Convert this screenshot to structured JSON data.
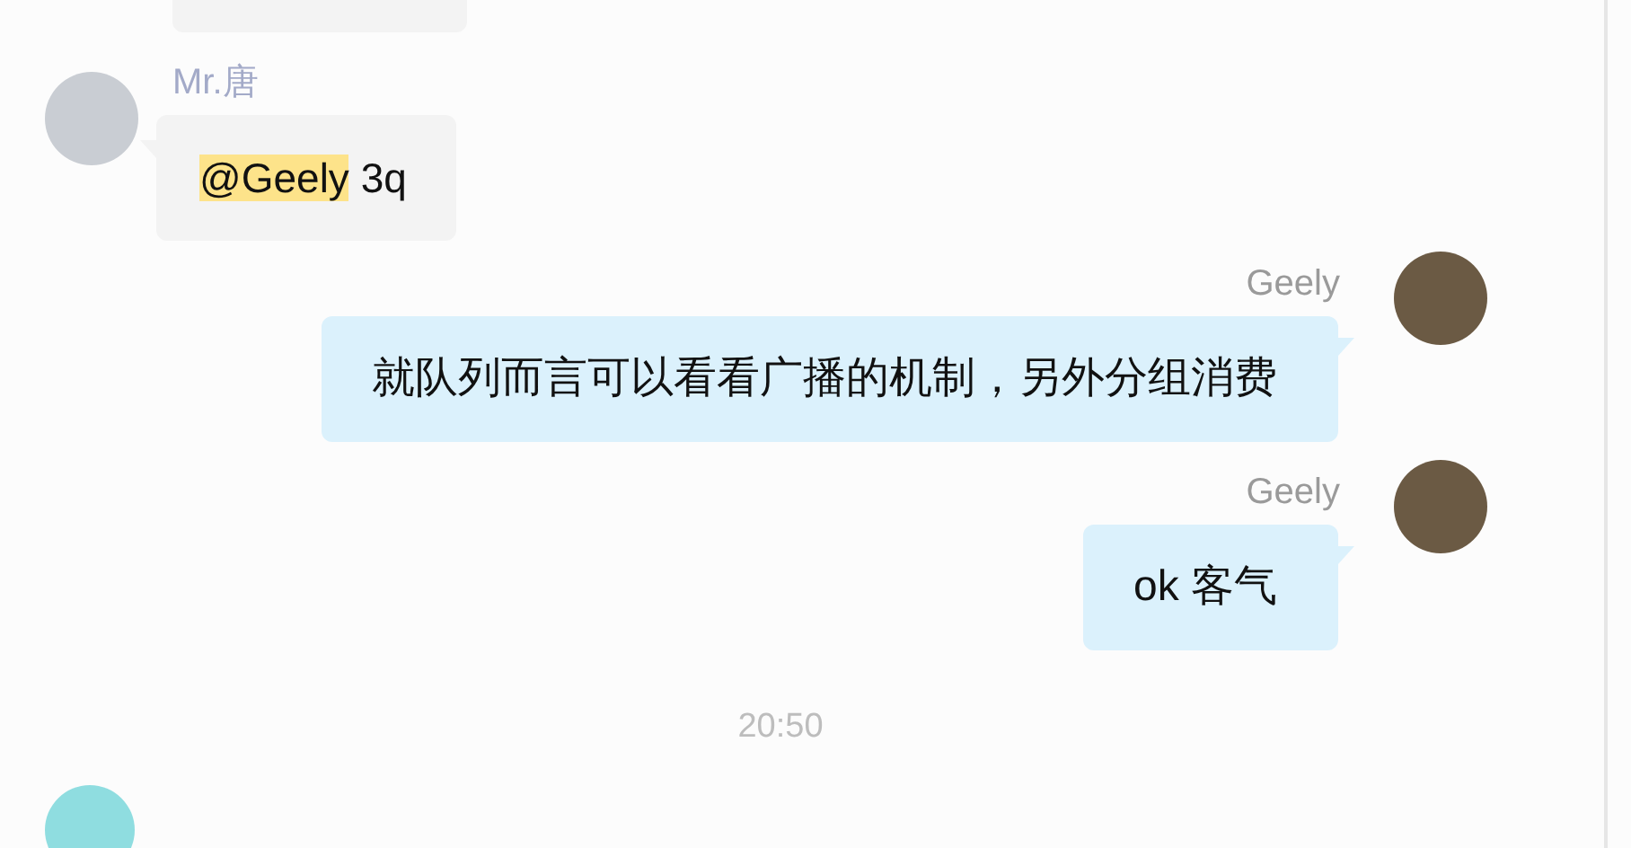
{
  "messages": [
    {
      "kind": "incoming",
      "sender": "Mr.唐",
      "mention": "@Geely",
      "text": "3q"
    },
    {
      "kind": "outgoing",
      "sender": "Geely",
      "text": "就队列而言可以看看广播的机制，另外分组消费"
    },
    {
      "kind": "outgoing",
      "sender": "Geely",
      "text": "ok 客气"
    },
    {
      "kind": "time",
      "text": "20:50"
    }
  ]
}
